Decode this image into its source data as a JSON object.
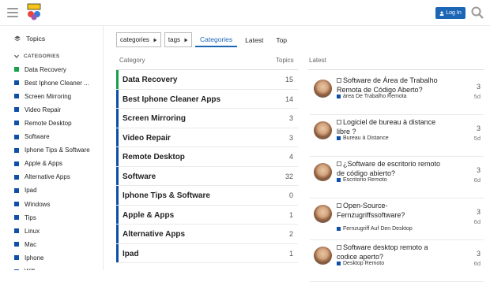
{
  "header": {
    "login_label": "Log In",
    "accent": "#1c66b5"
  },
  "sidebar": {
    "topics_label": "Topics",
    "categories_heading": "CATEGORIES",
    "items": [
      {
        "label": "Data Recovery",
        "color": "#18a04b"
      },
      {
        "label": "Best Iphone Cleaner ...",
        "color": "#0e4fa8"
      },
      {
        "label": "Screen Mirroring",
        "color": "#0e4fa8"
      },
      {
        "label": "Video Repair",
        "color": "#0e4fa8"
      },
      {
        "label": "Remote Desktop",
        "color": "#0e4fa8"
      },
      {
        "label": "Software",
        "color": "#0e4fa8"
      },
      {
        "label": "Iphone Tips & Software",
        "color": "#0e4fa8"
      },
      {
        "label": "Apple & Apps",
        "color": "#0e4fa8"
      },
      {
        "label": "Alternative Apps",
        "color": "#0e4fa8"
      },
      {
        "label": "Ipad",
        "color": "#0e4fa8"
      },
      {
        "label": "Windows",
        "color": "#0e4fa8"
      },
      {
        "label": "Tips",
        "color": "#0e4fa8"
      },
      {
        "label": "Linux",
        "color": "#0e4fa8"
      },
      {
        "label": "Mac",
        "color": "#0e4fa8"
      },
      {
        "label": "Iphone",
        "color": "#0e4fa8"
      },
      {
        "label": "Wifi",
        "color": "#0e4fa8"
      }
    ]
  },
  "nav": {
    "categories_dropdown": "categories",
    "tags_dropdown": "tags",
    "tabs": [
      "Categories",
      "Latest",
      "Top"
    ]
  },
  "columns": {
    "category": "Category",
    "topics": "Topics",
    "latest": "Latest"
  },
  "categories": [
    {
      "name": "Data Recovery",
      "count": "15"
    },
    {
      "name": "Best Iphone Cleaner Apps",
      "count": "14"
    },
    {
      "name": "Screen Mirroring",
      "count": "3"
    },
    {
      "name": "Video Repair",
      "count": "3"
    },
    {
      "name": "Remote Desktop",
      "count": "4"
    },
    {
      "name": "Software",
      "count": "32"
    },
    {
      "name": "Iphone Tips & Software",
      "count": "0"
    },
    {
      "name": "Apple & Apps",
      "count": "1"
    },
    {
      "name": "Alternative Apps",
      "count": "2"
    },
    {
      "name": "Ipad",
      "count": "1"
    }
  ],
  "latest": [
    {
      "title": "Software de Área de Trabalho Remota de Código Aberto?",
      "category": "área De Trabalho Remota",
      "posts": "3",
      "age": "5d"
    },
    {
      "title": "Logiciel de bureau à distance libre ?",
      "category": "Bureau à Distance",
      "posts": "3",
      "age": "5d"
    },
    {
      "title": "¿Software de escritorio remoto de código abierto?",
      "category": "Escritorio Remoto",
      "posts": "3",
      "age": "6d"
    },
    {
      "title": "Open-Source-Fernzugriffssoftware?",
      "category": "Fernzugriff Auf Den Desktop",
      "posts": "3",
      "age": "6d"
    },
    {
      "title": "Software desktop remoto a codice aperto?",
      "category": "Desktop Remoto",
      "posts": "3",
      "age": "6d"
    }
  ]
}
